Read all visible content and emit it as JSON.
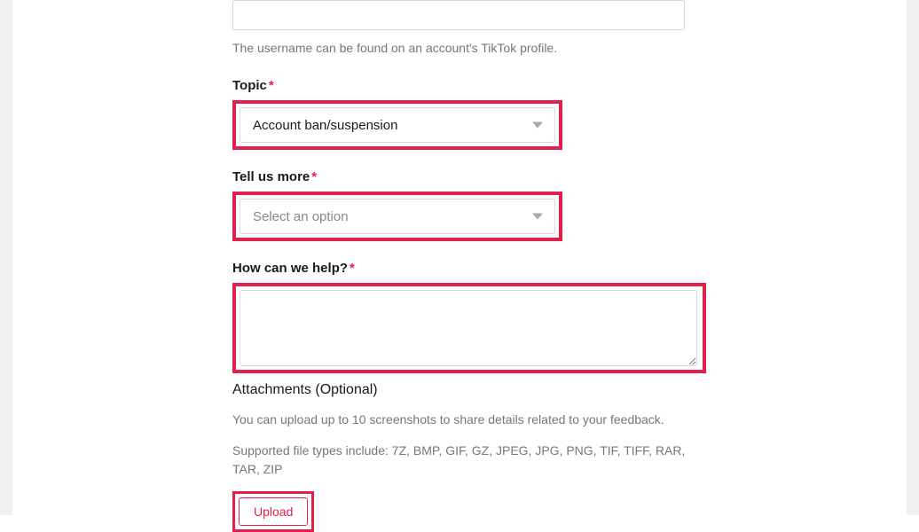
{
  "username": {
    "helper": "The username can be found on an account's TikTok profile."
  },
  "topic": {
    "label": "Topic",
    "value": "Account ban/suspension"
  },
  "tellUsMore": {
    "label": "Tell us more",
    "placeholder": "Select an option"
  },
  "howHelp": {
    "label": "How can we help?"
  },
  "attachments": {
    "label": "Attachments (Optional)",
    "info1": "You can upload up to 10 screenshots to share details related to your feedback.",
    "info2": "Supported file types include: 7Z, BMP, GIF, GZ, JPEG, JPG, PNG, TIF, TIFF, RAR, TAR, ZIP",
    "uploadLabel": "Upload"
  },
  "requiredMark": "*"
}
